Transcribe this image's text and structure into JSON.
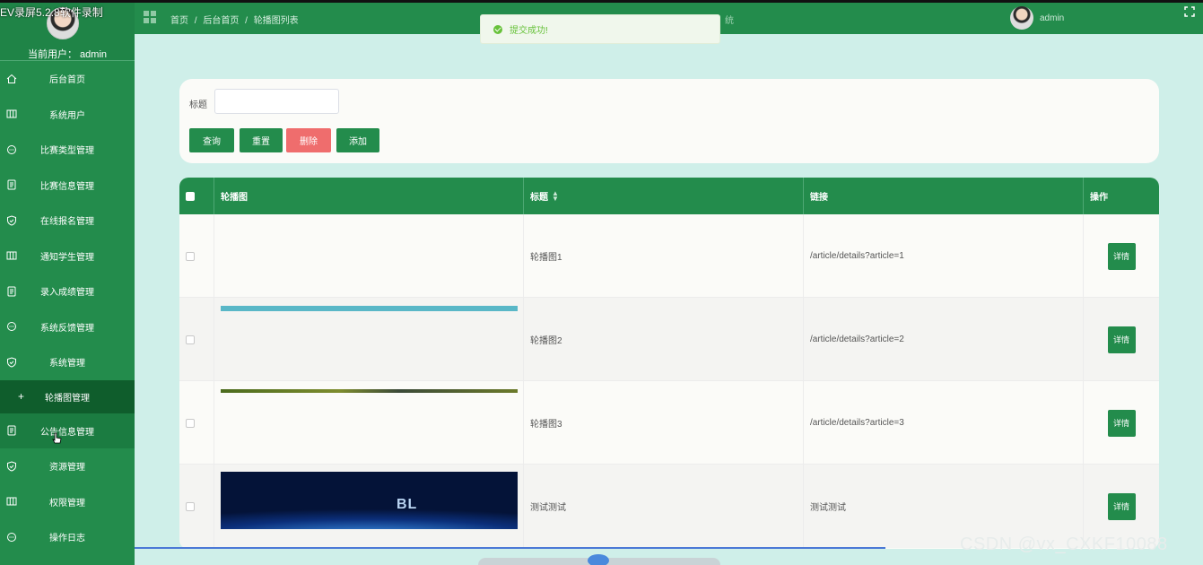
{
  "recorder": {
    "title": "EV录屏5.2.8软件录制"
  },
  "sidebar": {
    "current_user": "当前用户：  admin",
    "items": [
      {
        "label": "后台首页",
        "icon": "home-icon"
      },
      {
        "label": "系统用户",
        "icon": "columns-icon"
      },
      {
        "label": "比赛类型管理",
        "icon": "chat-icon"
      },
      {
        "label": "比赛信息管理",
        "icon": "document-icon"
      },
      {
        "label": "在线报名管理",
        "icon": "shield-icon"
      },
      {
        "label": "通知学生管理",
        "icon": "columns-icon"
      },
      {
        "label": "录入成绩管理",
        "icon": "document-icon"
      },
      {
        "label": "系统反馈管理",
        "icon": "chat-icon"
      },
      {
        "label": "系统管理",
        "icon": "shield-icon"
      }
    ],
    "sub_item": {
      "label": "轮播图管理",
      "icon": "plus-icon"
    },
    "items_after": [
      {
        "label": "公告信息管理",
        "icon": "document-icon"
      },
      {
        "label": "资源管理",
        "icon": "shield-icon"
      },
      {
        "label": "权限管理",
        "icon": "columns-icon"
      },
      {
        "label": "操作日志",
        "icon": "chat-icon"
      }
    ]
  },
  "header": {
    "breadcrumb": [
      "首页",
      "/",
      "后台首页",
      "/",
      "轮播图列表"
    ],
    "center_text": "统",
    "user": "admin"
  },
  "toast": {
    "message": "提交成功!"
  },
  "search": {
    "title_label": "标题",
    "title_value": "",
    "buttons": {
      "query": "查询",
      "reset": "重置",
      "delete": "删除",
      "add": "添加"
    }
  },
  "table": {
    "columns": {
      "image": "轮播图",
      "title": "标题",
      "link": "链接",
      "actions": "操作"
    },
    "rows": [
      {
        "title": "轮播图1",
        "link": "/article/details?article=1",
        "action": "详情"
      },
      {
        "title": "轮播图2",
        "link": "/article/details?article=2",
        "action": "详情"
      },
      {
        "title": "轮播图3",
        "link": "/article/details?article=3",
        "action": "详情"
      },
      {
        "title": "测试测试",
        "link": "测试测试",
        "action": "详情",
        "image_text": "BL"
      }
    ]
  },
  "watermark": "CSDN @vx_CXKF10088",
  "colors": {
    "primary": "#238c4c",
    "danger": "#ef6d6d",
    "background": "#cfefe9",
    "success": "#67c23a"
  }
}
